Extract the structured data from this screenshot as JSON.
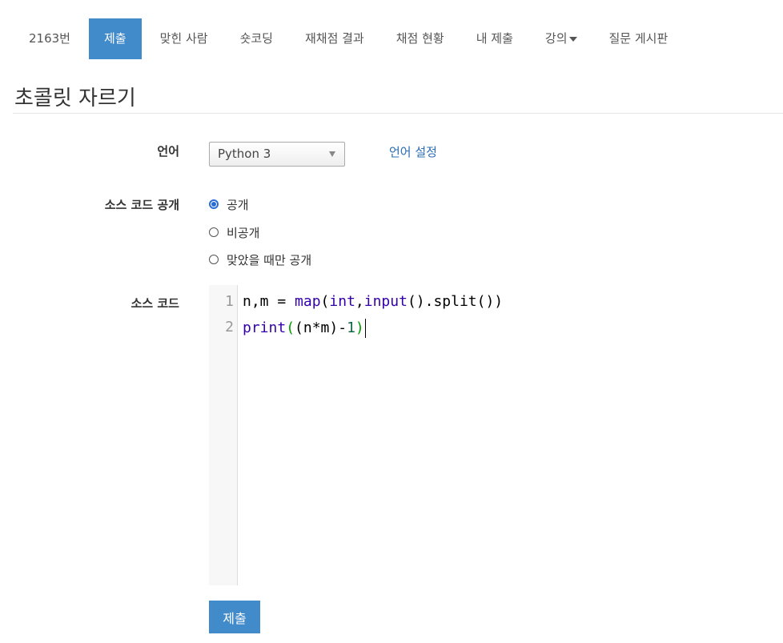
{
  "tabs": [
    {
      "label": "2163번",
      "active": false
    },
    {
      "label": "제출",
      "active": true
    },
    {
      "label": "맞힌 사람",
      "active": false
    },
    {
      "label": "숏코딩",
      "active": false
    },
    {
      "label": "재채점 결과",
      "active": false
    },
    {
      "label": "채점 현황",
      "active": false
    },
    {
      "label": "내 제출",
      "active": false
    },
    {
      "label": "강의",
      "active": false,
      "dropdown": true
    },
    {
      "label": "질문 게시판",
      "active": false
    }
  ],
  "page_title": "초콜릿 자르기",
  "form": {
    "language_label": "언어",
    "language_value": "Python 3",
    "language_settings_link": "언어 설정",
    "visibility_label": "소스 코드 공개",
    "visibility_options": [
      {
        "label": "공개",
        "checked": true
      },
      {
        "label": "비공개",
        "checked": false
      },
      {
        "label": "맞았을 때만 공개",
        "checked": false
      }
    ],
    "code_label": "소스 코드",
    "submit_label": "제출"
  },
  "editor": {
    "line_numbers": [
      "1",
      "2"
    ],
    "lines": [
      "n,m = map(int,input().split())",
      "print((n*m)-1)"
    ]
  },
  "colors": {
    "accent": "#428bca",
    "link": "#2a6eb3",
    "keyword": "#3300aa",
    "number": "#116644",
    "matched_paren": "#009900",
    "radio_checked": "#2a6bd6"
  }
}
